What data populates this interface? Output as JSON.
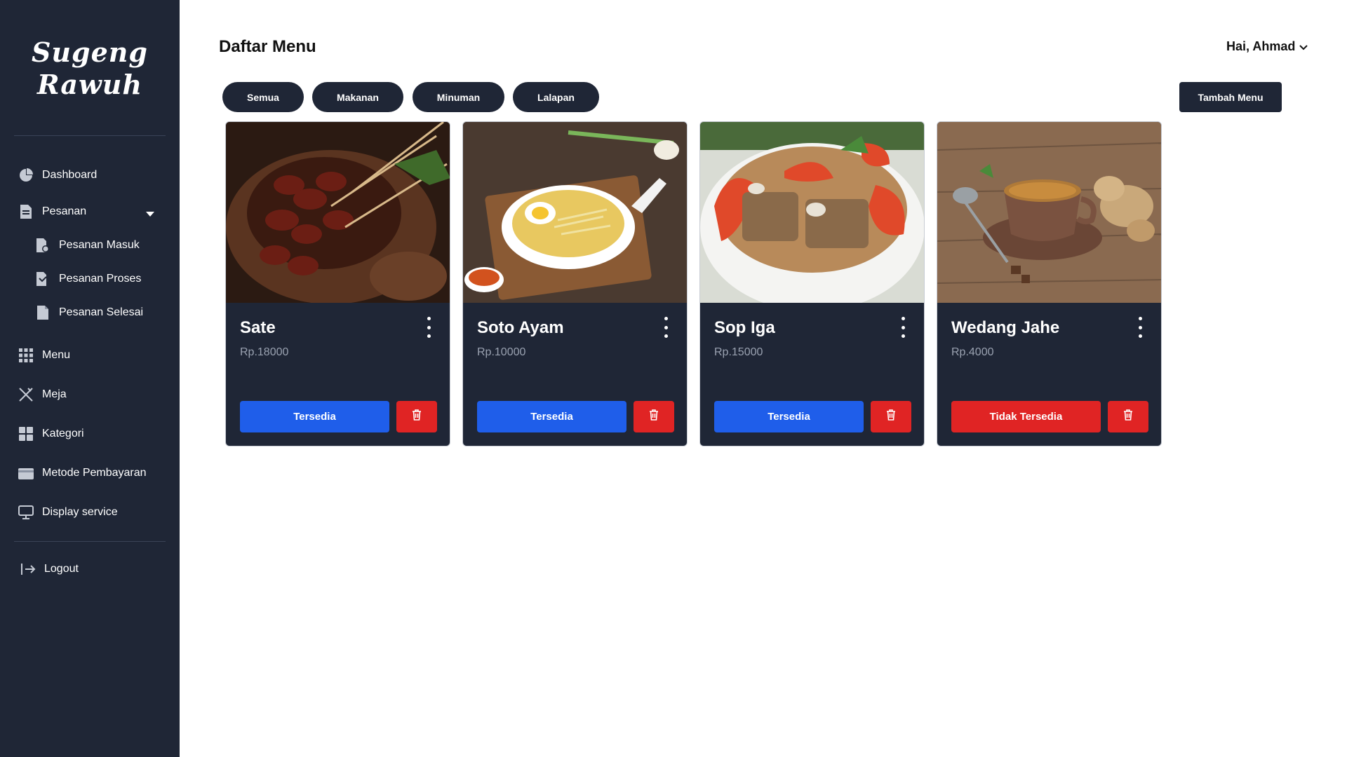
{
  "brand": {
    "line1": "Sugeng",
    "line2": "Rawuh"
  },
  "sidebar": {
    "items": [
      {
        "label": "Dashboard",
        "icon": "pie-chart-icon"
      },
      {
        "label": "Pesanan",
        "icon": "document-icon"
      },
      {
        "label": "Pesanan Masuk",
        "icon": "document-in-icon"
      },
      {
        "label": "Pesanan Proses",
        "icon": "document-process-icon"
      },
      {
        "label": "Pesanan Selesai",
        "icon": "document-done-icon"
      },
      {
        "label": "Menu",
        "icon": "grid-icon"
      },
      {
        "label": "Meja",
        "icon": "utensils-icon"
      },
      {
        "label": "Kategori",
        "icon": "category-icon"
      },
      {
        "label": "Metode Pembayaran",
        "icon": "wallet-icon"
      },
      {
        "label": "Display service",
        "icon": "monitor-icon"
      }
    ],
    "logout": {
      "label": "Logout",
      "icon": "logout-icon"
    }
  },
  "header": {
    "title": "Daftar Menu",
    "user_greeting": "Hai, Ahmad"
  },
  "filters": [
    "Semua",
    "Makanan",
    "Minuman",
    "Lalapan"
  ],
  "add_button": "Tambah Menu",
  "menu_items": [
    {
      "name": "Sate",
      "price": "Rp.18000",
      "status": "Tersedia",
      "status_color": "#1f5eea"
    },
    {
      "name": "Soto Ayam",
      "price": "Rp.10000",
      "status": "Tersedia",
      "status_color": "#1f5eea"
    },
    {
      "name": "Sop Iga",
      "price": "Rp.15000",
      "status": "Tersedia",
      "status_color": "#1f5eea"
    },
    {
      "name": "Wedang Jahe",
      "price": "Rp.4000",
      "status": "Tidak Tersedia",
      "status_color": "#e02424"
    }
  ],
  "colors": {
    "sidebar_bg": "#1f2636",
    "available": "#1f5eea",
    "unavailable": "#e02424",
    "delete": "#e02424"
  }
}
